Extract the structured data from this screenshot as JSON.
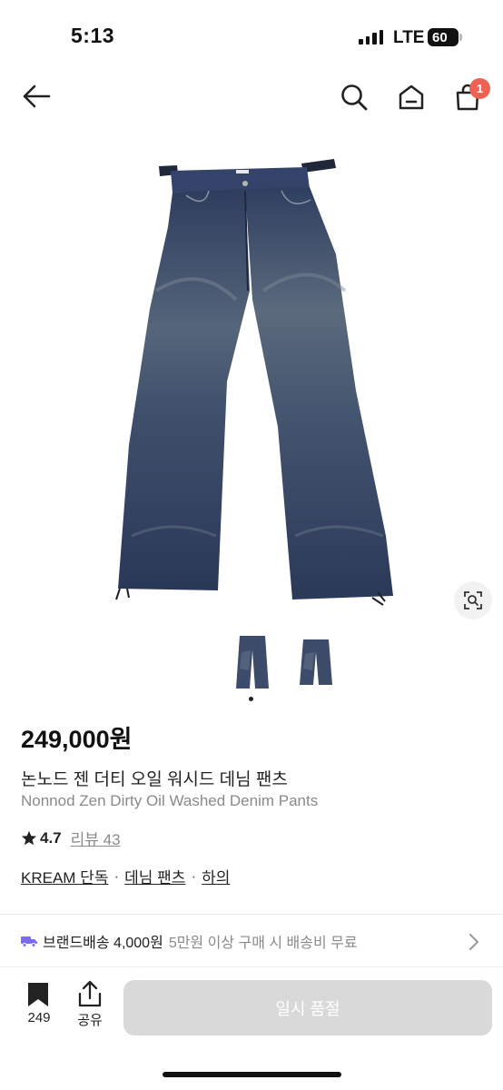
{
  "status_bar": {
    "time": "5:13",
    "network": "LTE",
    "battery": "60"
  },
  "header": {
    "cart_count": "1"
  },
  "product": {
    "price": "249,000원",
    "name_ko": "논노드 젠 더티 오일 워시드 데님 팬츠",
    "name_en": "Nonnod Zen Dirty Oil Washed Denim Pants",
    "rating": "4.7",
    "review_label": "리뷰 43",
    "tags": [
      "KREAM 단독",
      "데님 팬츠",
      "하의"
    ],
    "tag_separator": "·",
    "image_count": 2,
    "active_image": 1
  },
  "shipping": {
    "label": "브랜드배송 4,000원",
    "note": "5만원 이상 구매 시 배송비 무료"
  },
  "bottom_bar": {
    "save_count": "249",
    "share_label": "공유",
    "buy_label": "일시 품절"
  },
  "colors": {
    "badge": "#ef6253",
    "shipping_icon": "#7b6cf6",
    "disabled_button": "#d9d9d9",
    "denim": "#2d3c5e"
  },
  "icons": [
    "back-arrow-icon",
    "search-icon",
    "home-icon",
    "cart-icon",
    "lens-search-icon",
    "truck-icon",
    "chevron-right-icon",
    "bookmark-icon",
    "share-icon",
    "star-icon"
  ]
}
